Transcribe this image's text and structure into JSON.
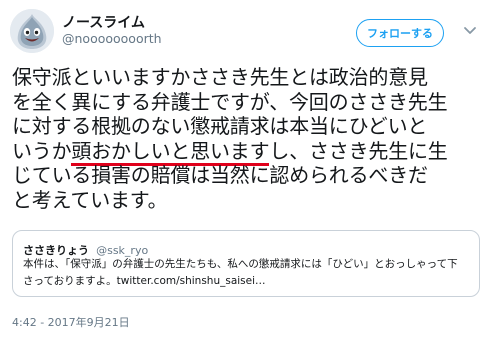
{
  "author": {
    "display_name": "ノースライム",
    "handle": "@noooooooorth"
  },
  "follow_button": {
    "label": "フォローする"
  },
  "tweet": {
    "lines": [
      [
        {
          "text": "保守派といいますかささき先生とは政治的意見"
        }
      ],
      [
        {
          "text": "を全く異にする弁護士ですが、今回のささき先生"
        }
      ],
      [
        {
          "text": "に対する根拠のない懲戒請求は本当にひどいと"
        }
      ],
      [
        {
          "text": "いうか"
        },
        {
          "text": "頭おかしいと思います",
          "underline": true
        },
        {
          "text": "し、ささき先生に生"
        }
      ],
      [
        {
          "text": "じている損害の賠償は当然に認められるべきだ"
        }
      ],
      [
        {
          "text": "と考えています。"
        }
      ]
    ],
    "underline_color": "#e0001b"
  },
  "quoted_tweet": {
    "name": "ささきりょう",
    "handle": "@ssk_ryo",
    "body_lines": [
      "本件は、「保守派」の弁護士の先生たちも、私への懲戒請求には「ひどい」とおっしゃって下",
      "さっておりますよ。twitter.com/shinshu_saisei…"
    ]
  },
  "timestamp": "4:42 - 2017年9月21日",
  "colors": {
    "accent": "#1da1f2",
    "text": "#14171a",
    "secondary_text": "#657786",
    "border": "#c9d1d9"
  },
  "icons": {
    "avatar": "slime-avatar-icon",
    "menu": "chevron-down-icon"
  }
}
